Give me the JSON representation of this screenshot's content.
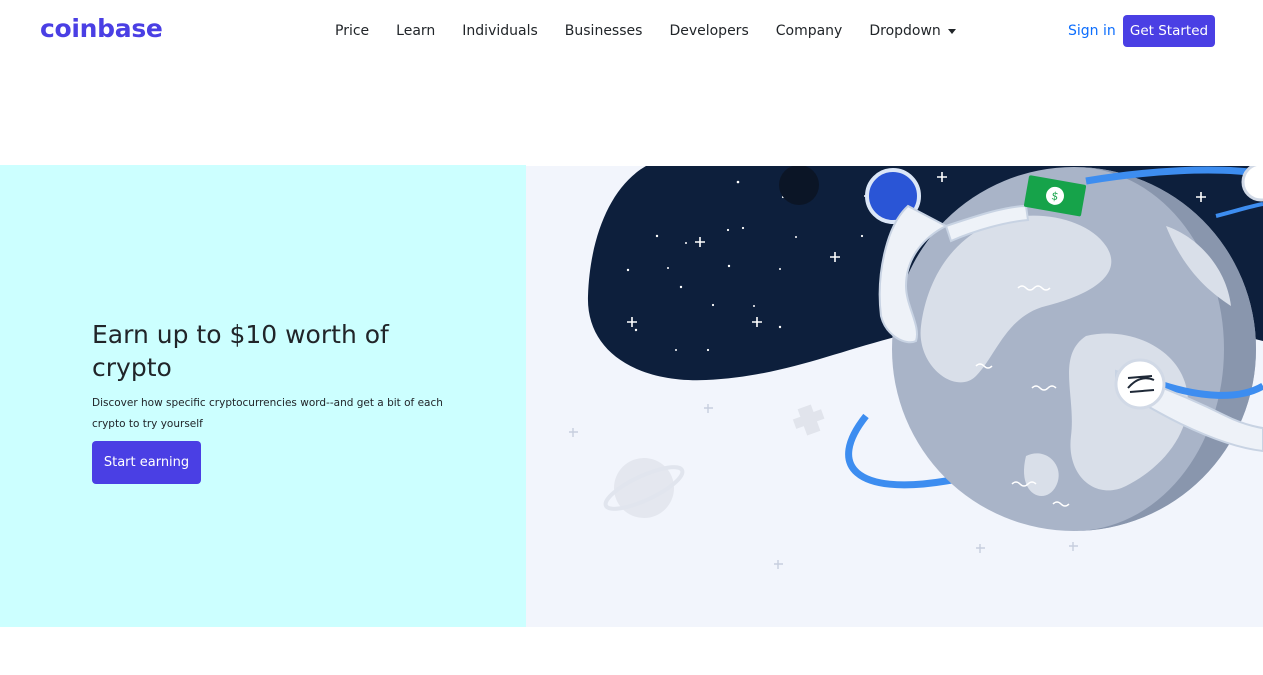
{
  "brand": {
    "name": "coinbase",
    "color": "#4a3fe4"
  },
  "nav": {
    "items": [
      {
        "label": "Price"
      },
      {
        "label": "Learn"
      },
      {
        "label": "Individuals"
      },
      {
        "label": "Businesses"
      },
      {
        "label": "Developers"
      },
      {
        "label": "Company"
      }
    ],
    "dropdown_label": "Dropdown",
    "dropdown_icon": "caret-down-icon",
    "signin_label": "Sign in",
    "cta_label": "Get Started"
  },
  "hero": {
    "title": "Earn up to $10 worth of crypto",
    "subtitle": "Discover how specific cryptocurrencies word--and get a bit of each crypto to try yourself",
    "cta_label": "Start earning",
    "background_color": "#ccffff",
    "illustration": "astronaut-earth-illustration",
    "bill_symbol": "$"
  },
  "colors": {
    "primary": "#4a3fe4",
    "link": "#0d6efd",
    "space": "#0d1f3c",
    "orbit": "#3d8df0"
  }
}
